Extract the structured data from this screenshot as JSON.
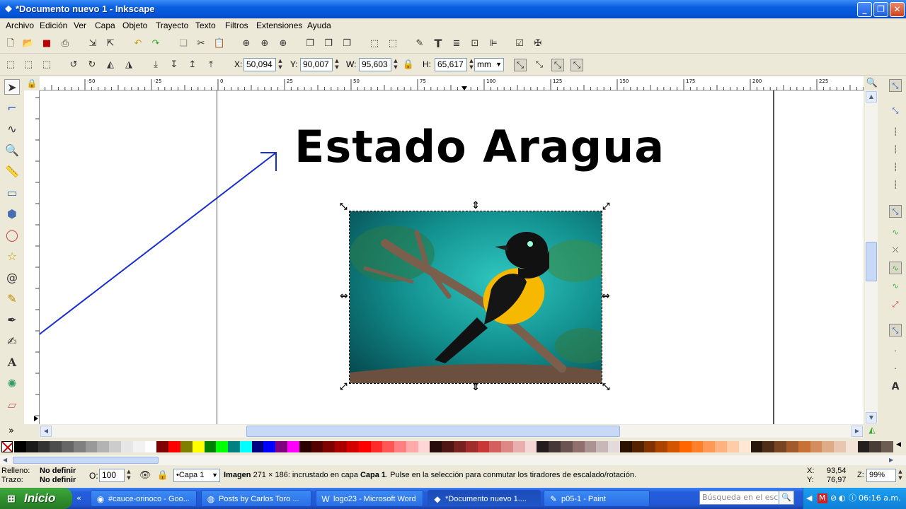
{
  "window": {
    "title": "*Documento nuevo 1 - Inkscape",
    "app_icon": "inkscape-icon"
  },
  "menu": [
    "Archivo",
    "Edición",
    "Ver",
    "Capa",
    "Objeto",
    "Trayecto",
    "Texto",
    "Filtros",
    "Extensiones",
    "Ayuda"
  ],
  "select_toolbar": {
    "x_label": "X:",
    "x_value": "50,094",
    "y_label": "Y:",
    "y_value": "90,007",
    "w_label": "W:",
    "w_value": "95,603",
    "h_label": "H:",
    "h_value": "65,617",
    "unit": "mm"
  },
  "ruler_top_ticks": [
    "-50",
    "-25",
    "0",
    "25",
    "50",
    "75",
    "100",
    "125",
    "150",
    "175",
    "200",
    "225"
  ],
  "canvas": {
    "heading": "Estado Aragua",
    "image_alt": "bird-photo"
  },
  "status": {
    "fill_label": "Relleno:",
    "fill_value": "No definir",
    "stroke_label": "Trazo:",
    "stroke_value": "No definir",
    "opacity_label": "O:",
    "opacity_value": "100",
    "layer": "•Capa 1",
    "msg_bold1": "Imagen",
    "msg_mid": " 271 × 186: incrustado en capa ",
    "msg_bold2": "Capa 1",
    "msg_end": ". Pulse en la selección para conmutar los tiradores de escalado/rotación.",
    "coord_x_label": "X:",
    "coord_x": "93,54",
    "coord_y_label": "Y:",
    "coord_y": "76,97",
    "zoom_label": "Z:",
    "zoom": "99%"
  },
  "taskbar": {
    "start": "Inicio",
    "tasks": [
      {
        "label": "#cauce-orinoco - Goo...",
        "icon": "chrome-icon"
      },
      {
        "label": "Posts by Carlos Toro ...",
        "icon": "firefox-icon"
      },
      {
        "label": "logo23 - Microsoft Word",
        "icon": "word-icon"
      },
      {
        "label": "*Documento nuevo 1....",
        "icon": "inkscape-icon"
      },
      {
        "label": "p05-1 - Paint",
        "icon": "paint-icon"
      }
    ],
    "search_placeholder": "Búsqueda en el escrit",
    "time": "06:16 a.m."
  },
  "palette_colors": [
    "#000000",
    "#1a1a1a",
    "#333333",
    "#4d4d4d",
    "#666666",
    "#808080",
    "#999999",
    "#b3b3b3",
    "#cccccc",
    "#e6e6e6",
    "#f2f2f2",
    "#ffffff",
    "#800000",
    "#ff0000",
    "#808000",
    "#ffff00",
    "#008000",
    "#00ff00",
    "#008080",
    "#00ffff",
    "#000080",
    "#0000ff",
    "#800080",
    "#ff00ff",
    "#2b0000",
    "#550000",
    "#800000",
    "#aa0000",
    "#d40000",
    "#ff0000",
    "#ff2a2a",
    "#ff5555",
    "#ff8080",
    "#ffaaaa",
    "#ffd5d5",
    "#280b0b",
    "#501616",
    "#782121",
    "#a02c2c",
    "#c83737",
    "#d35f5f",
    "#de8787",
    "#e9afaf",
    "#f4d7d7",
    "#241c1c",
    "#483737",
    "#6c5353",
    "#916f6f",
    "#ac9393",
    "#c8b7b7",
    "#e3dbdb",
    "#2b1100",
    "#552200",
    "#803300",
    "#aa4400",
    "#d45500",
    "#ff6600",
    "#ff7f2a",
    "#ff9955",
    "#ffb380",
    "#ffccaa",
    "#ffe6d5",
    "#28170b",
    "#502d16",
    "#784421",
    "#a05a2c",
    "#c87137",
    "#d38d5f",
    "#deaa87",
    "#e9c6af",
    "#f4e3d7",
    "#241f1c",
    "#483e37",
    "#6c5d53"
  ]
}
